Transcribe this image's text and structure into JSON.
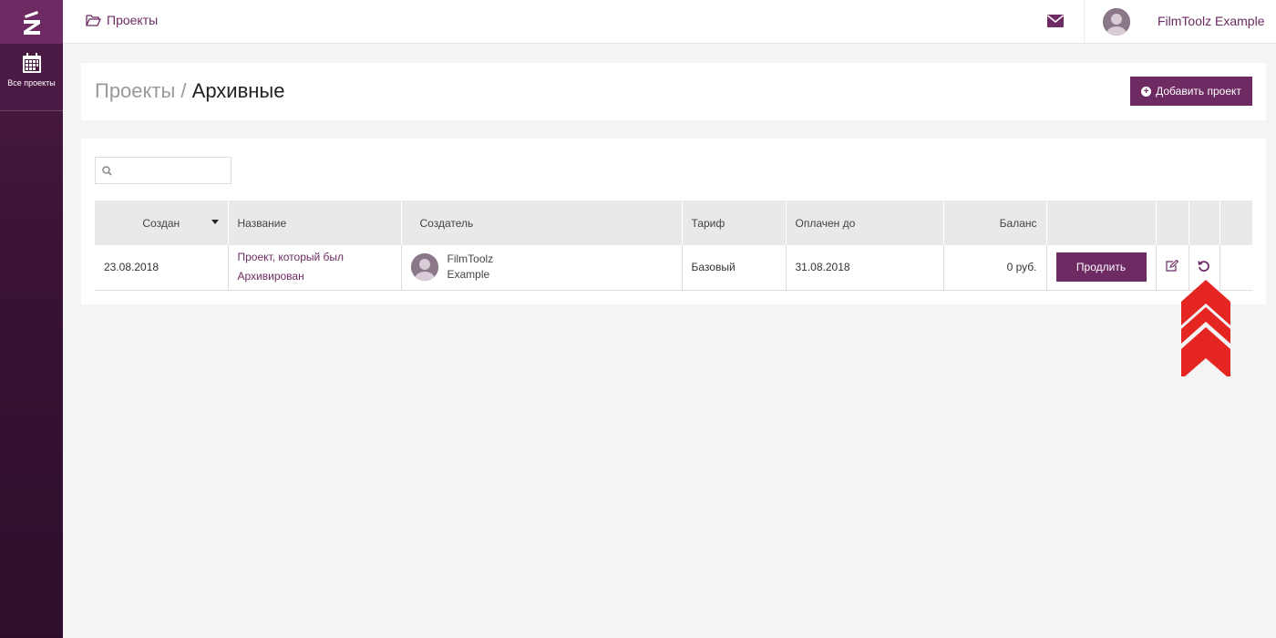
{
  "sidebar": {
    "logo_icon": "filmtoolz-z-logo-icon",
    "items": [
      {
        "icon": "calendar-icon",
        "label": "Все проекты"
      }
    ]
  },
  "topbar": {
    "breadcrumb_icon": "folder-open-icon",
    "breadcrumb_label": "Проекты",
    "mail_icon": "envelope-icon",
    "user_name": "FilmToolz Example"
  },
  "header": {
    "title_parent": "Проекты /",
    "title_current": "Архивные",
    "add_button_label": "Добавить проект"
  },
  "search": {
    "placeholder": "",
    "value": ""
  },
  "table": {
    "columns": {
      "created": "Создан",
      "name": "Название",
      "creator": "Создатель",
      "tariff": "Тариф",
      "paid_until": "Оплачен до",
      "balance": "Баланс"
    },
    "sort_column": "created",
    "rows": [
      {
        "created": "23.08.2018",
        "name_line1": "Проект, который был",
        "name_line2": "Архивирован",
        "creator_line1": "FilmToolz",
        "creator_line2": "Example",
        "tariff": "Базовый",
        "paid_until": "31.08.2018",
        "balance": "0 руб.",
        "extend_label": "Продлить",
        "edit_icon": "edit-icon",
        "restore_icon": "restore-icon"
      }
    ]
  },
  "colors": {
    "brand": "#6d2a63",
    "sidebar": "#3a1236",
    "annotation": "#e52521"
  }
}
